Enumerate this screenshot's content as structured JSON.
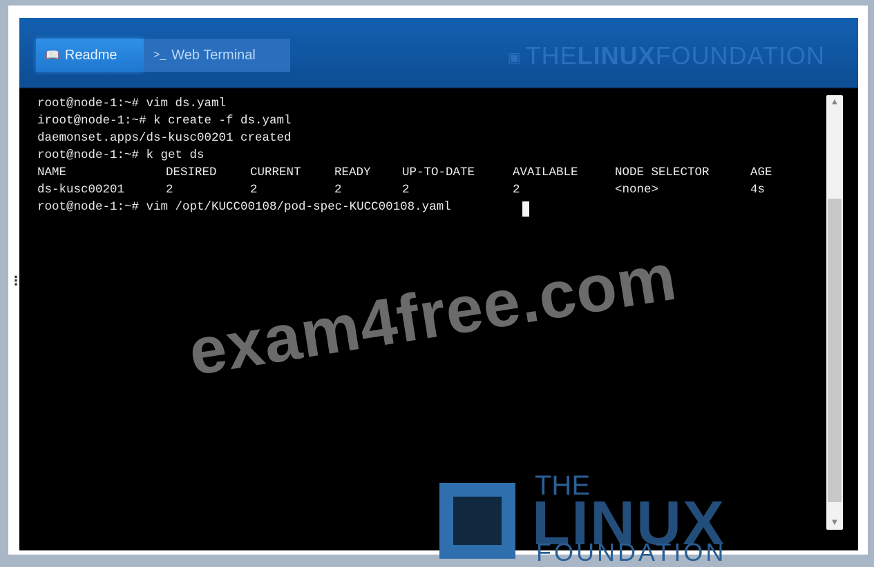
{
  "header": {
    "tabs": [
      {
        "icon": "book-icon",
        "label": "Readme"
      },
      {
        "icon": "terminal-prompt-icon",
        "label": "Web Terminal"
      }
    ],
    "brand": {
      "the": "THE",
      "linux": "LINUX",
      "foundation": "FOUNDATION"
    }
  },
  "terminal": {
    "lines": [
      "root@node-1:~# vim ds.yaml",
      "iroot@node-1:~# k create -f ds.yaml",
      "daemonset.apps/ds-kusc00201 created",
      "root@node-1:~# k get ds"
    ],
    "table": {
      "headers": [
        "NAME",
        "DESIRED",
        "CURRENT",
        "READY",
        "UP-TO-DATE",
        "AVAILABLE",
        "NODE SELECTOR",
        "AGE"
      ],
      "row": [
        "ds-kusc00201",
        "2",
        "2",
        "2",
        "2",
        "2",
        "<none>",
        "4s"
      ]
    },
    "last_line": "root@node-1:~# vim /opt/KUCC00108/pod-spec-KUCC00108.yaml"
  },
  "watermark": "exam4free.com",
  "logo": {
    "the": "THE",
    "linux": "LINUX",
    "foundation": "FOUNDATION"
  }
}
